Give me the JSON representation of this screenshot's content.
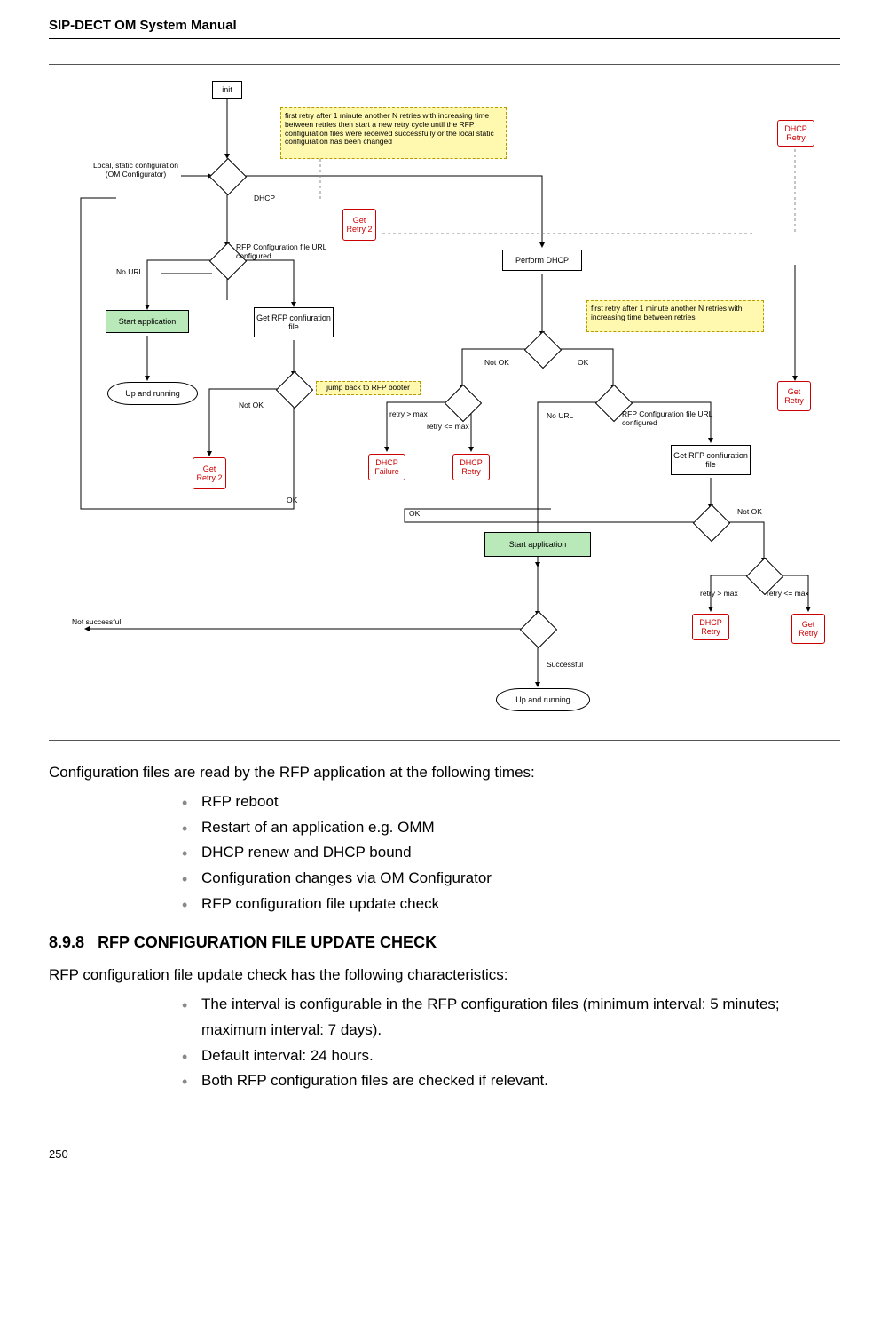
{
  "header": {
    "title": "SIP-DECT OM System Manual"
  },
  "chart_data": {
    "type": "flowchart",
    "nodes": {
      "init": "init",
      "local_static": "Local, static configuration\n(OM Configurator)",
      "note1": "first retry after 1 minute\nanother N retries with increasing time between retries\nthen start a new retry cycle\nuntil the RFP configuration files were received successfully\nor the local static configuration has been changed",
      "dhcp_retry_top": "DHCP\nRetry",
      "get_retry2_top": "Get\nRetry\n2",
      "perform_dhcp": "Perform DHCP",
      "no_url": "No URL",
      "rfp_conf_url": "RFP Configuration file\nURL configured",
      "start_app1": "Start application",
      "get_rfp1": "Get RFP\nconfiuration file",
      "note2": "first retry after 1 minute\nanother N retries with increasing time\nbetween retries",
      "up_running1": "Up and running",
      "jump_back": "jump back to RFP booter",
      "not_ok": "Not OK",
      "ok": "OK",
      "retry_gt_max": "retry > max",
      "retry_le_max": "retry <=  max",
      "get_retry2_mid": "Get\nRetry\n2",
      "dhcp_failure": "DHCP\nFailure",
      "dhcp_retry_mid": "DHCP\nRetry",
      "no_url2": "No URL",
      "rfp_conf_url2": "RFP Configuration file\nURL configured",
      "get_retry_right": "Get\nRetry",
      "get_rfp2": "Get RFP\nconfiuration file",
      "start_app2": "Start application",
      "not_successful": "Not successful",
      "successful": "Successful",
      "up_running2": "Up and running",
      "dhcp_retry_br": "DHCP\nRetry",
      "get_retry_br": "Get\nRetry",
      "dhcp_lbl": "DHCP"
    }
  },
  "para1": "Configuration files are read by the RFP application at the following times:",
  "bullets1": [
    "RFP reboot",
    "Restart of an application e.g. OMM",
    "DHCP renew and DHCP bound",
    "Configuration changes via OM Configurator",
    "RFP configuration file update check"
  ],
  "section": {
    "number": "8.9.8",
    "title": "RFP CONFIGURATION FILE UPDATE CHECK"
  },
  "para2": "RFP configuration file update check has the following characteristics:",
  "bullets2": [
    "The interval is configurable in the RFP configuration files (minimum interval: 5 minutes; maximum interval: 7 days).",
    "Default interval: 24 hours.",
    "Both RFP configuration files are checked if relevant."
  ],
  "page_number": "250"
}
